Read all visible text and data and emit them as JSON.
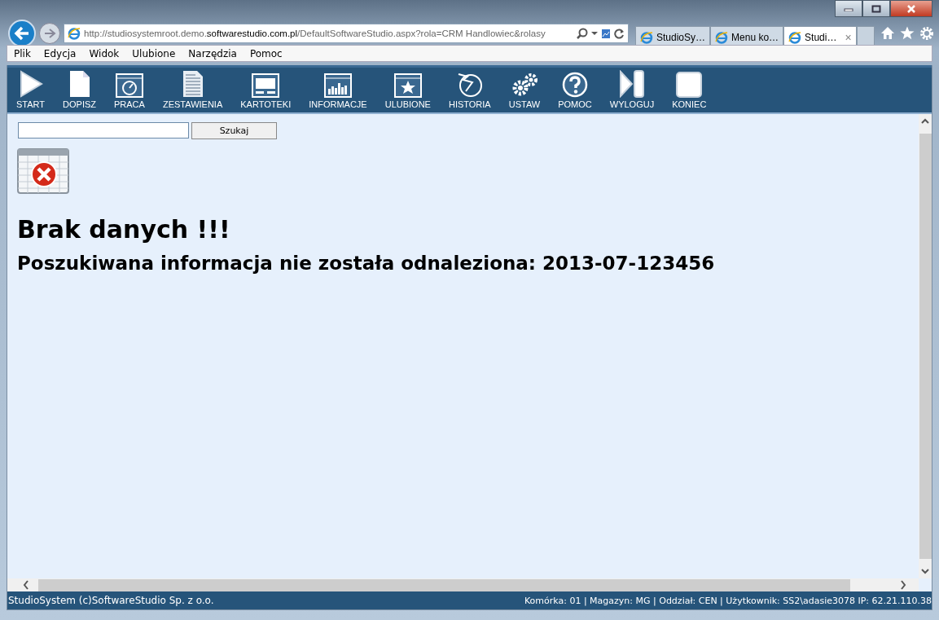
{
  "browser": {
    "address": "http://studiosystemroot.demo.**softwarestudio.com.pl**/DefaultSoftwareStudio.aspx?rola=CRM Handlowiec&rolasy",
    "tabs": [
      {
        "label": "StudioSy…",
        "selected": false
      },
      {
        "label": "Menu ko…",
        "selected": false
      },
      {
        "label": "Studi…",
        "selected": true,
        "close": "×"
      }
    ],
    "menu": [
      "Plik",
      "Edycja",
      "Widok",
      "Ulubione",
      "Narzędzia",
      "Pomoc"
    ]
  },
  "toolbar": [
    {
      "label": "START",
      "kind": "play"
    },
    {
      "label": "DOPISZ",
      "kind": "page"
    },
    {
      "label": "PRACA",
      "kind": "clock"
    },
    {
      "label": "ZESTAWIENIA",
      "kind": "report"
    },
    {
      "label": "KARTOTEKI",
      "kind": "screen"
    },
    {
      "label": "INFORMACJE",
      "kind": "chart"
    },
    {
      "label": "ULUBIONE",
      "kind": "star"
    },
    {
      "label": "HISTORIA",
      "kind": "history"
    },
    {
      "label": "USTAW",
      "kind": "gears"
    },
    {
      "label": "POMOC",
      "kind": "help"
    },
    {
      "label": "WYLOGUJ",
      "kind": "logout"
    },
    {
      "label": "KONIEC",
      "kind": "stop"
    }
  ],
  "search": {
    "button": "Szukaj"
  },
  "message": {
    "title": "Brak danych !!!",
    "detail": "Poszukiwana informacja nie została odnaleziona: 2013-07-123456"
  },
  "status_bar": {
    "left": "StudioSystem (c)SoftwareStudio Sp. z o.o.",
    "right": "Komórka: 01 | Magazyn: MG | Oddział: CEN | Użytkownik: SS2\\adasie3078 IP: 62.21.110.38"
  }
}
